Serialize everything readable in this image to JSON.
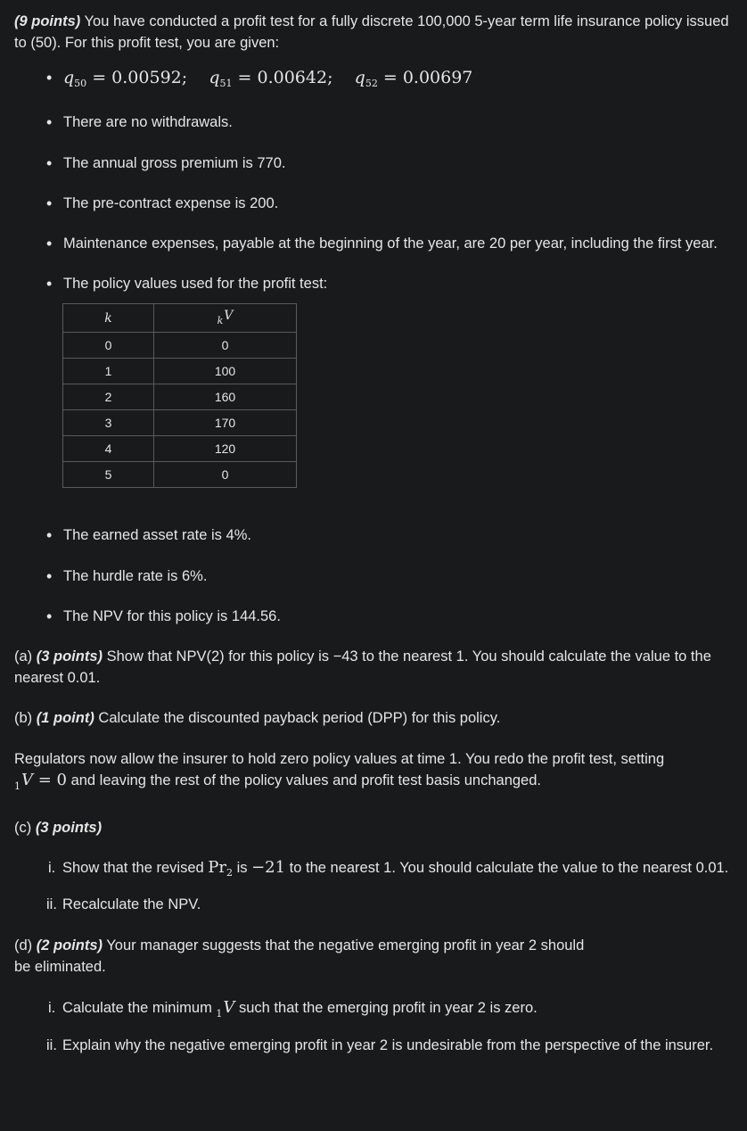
{
  "intro": {
    "points": "(9 points)",
    "text": " You have conducted a profit test for a fully discrete 100,000 5-year term life insurance policy issued to (50). For this profit test, you are given:"
  },
  "mortality": {
    "q50_sub": "50",
    "q50_val": "0.00592;",
    "q51_sub": "51",
    "q51_val": "0.00642;",
    "q52_sub": "52",
    "q52_val": "0.00697"
  },
  "givens": {
    "withdrawals": "There are no withdrawals.",
    "premium": "The annual gross premium is 770.",
    "precontract": "The pre-contract expense is 200.",
    "maintenance": "Maintenance expenses, payable at the beginning of the year, are 20 per year, including the first year.",
    "policy_values_intro": "The policy values used for the profit test:",
    "earned_rate": "The earned asset rate is 4%.",
    "hurdle": "The hurdle rate is 6%.",
    "npv": "The NPV for this policy is 144.56."
  },
  "table": {
    "col1_header": "k",
    "col2_header_sub": "k",
    "col2_header_main": "V",
    "rows": [
      {
        "k": "0",
        "v": "0"
      },
      {
        "k": "1",
        "v": "100"
      },
      {
        "k": "2",
        "v": "160"
      },
      {
        "k": "3",
        "v": "170"
      },
      {
        "k": "4",
        "v": "120"
      },
      {
        "k": "5",
        "v": "0"
      }
    ]
  },
  "part_a": {
    "label": "(a) ",
    "points": "(3 points)",
    "text": " Show that NPV(2) for this policy is −43 to the nearest 1. You should calculate the value to the nearest 0.01."
  },
  "part_b": {
    "label": "(b) ",
    "points": "(1 point)",
    "text": " Calculate the discounted payback period (DPP) for this policy."
  },
  "regulators": {
    "text1": "Regulators now allow the insurer to hold zero policy values at time 1. You redo the profit test, setting ",
    "presub": "1",
    "v": "V",
    "eq": " = 0",
    "text2": " and leaving the rest of the policy values and profit test basis unchanged."
  },
  "part_c": {
    "label": "(c) ",
    "points": "(3 points)",
    "i_marker": "i.",
    "i_text1": "Show that the revised ",
    "i_pr": "Pr",
    "i_pr_sub": "2",
    "i_is": " is ",
    "i_val": "−21",
    "i_text2": " to the nearest 1. You should calculate the value to the nearest 0.01.",
    "ii_marker": "ii.",
    "ii_text": "Recalculate the NPV."
  },
  "part_d": {
    "label": "(d) ",
    "points": "(2 points)",
    "text_line1": " Your manager suggests that the negative emerging profit in year 2 should",
    "text_line2": "be eliminated.",
    "i_marker": "i.",
    "i_text1": "Calculate the minimum ",
    "i_presub": "1",
    "i_v": "V",
    "i_text2": " such that the emerging profit in year 2 is zero.",
    "ii_marker": "ii.",
    "ii_text": "Explain why the negative emerging profit in year 2 is undesirable from the perspective of the insurer."
  }
}
